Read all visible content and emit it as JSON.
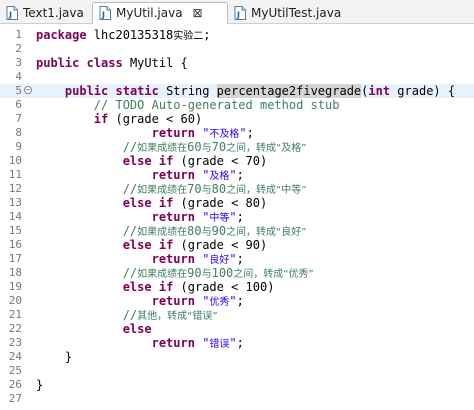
{
  "tabs": [
    {
      "label": "Text1.java",
      "active": false
    },
    {
      "label": "MyUtil.java",
      "active": true,
      "close": "⊠"
    },
    {
      "label": "MyUtilTest.java",
      "active": false
    }
  ],
  "editor": {
    "lines": [
      {
        "num": "1",
        "text": "package lhc20135318实验二;"
      },
      {
        "num": "2",
        "text": ""
      },
      {
        "num": "3",
        "text": "public class MyUtil {"
      },
      {
        "num": "4",
        "text": ""
      },
      {
        "num": "5",
        "text": "    public static String percentage2fivegrade(int grade) {"
      },
      {
        "num": "6",
        "text": "        // TODO Auto-generated method stub"
      },
      {
        "num": "7",
        "text": "        if (grade < 60)"
      },
      {
        "num": "8",
        "text": "                return \"不及格\";"
      },
      {
        "num": "9",
        "text": "            //如果成绩在60与70之间，转成“及格”"
      },
      {
        "num": "10",
        "text": "            else if (grade < 70)"
      },
      {
        "num": "11",
        "text": "                return \"及格\";"
      },
      {
        "num": "12",
        "text": "            //如果成绩在70与80之间，转成“中等”"
      },
      {
        "num": "13",
        "text": "            else if (grade < 80)"
      },
      {
        "num": "14",
        "text": "                return \"中等\";"
      },
      {
        "num": "15",
        "text": "            //如果成绩在80与90之间，转成“良好”"
      },
      {
        "num": "16",
        "text": "            else if (grade < 90)"
      },
      {
        "num": "17",
        "text": "                return \"良好\";"
      },
      {
        "num": "18",
        "text": "            //如果成绩在90与100之间，转成“优秀”"
      },
      {
        "num": "19",
        "text": "            else if (grade < 100)"
      },
      {
        "num": "20",
        "text": "                return \"优秀\";"
      },
      {
        "num": "21",
        "text": "            //其他，转成“错误”"
      },
      {
        "num": "22",
        "text": "            else"
      },
      {
        "num": "23",
        "text": "                return \"错误\";"
      },
      {
        "num": "24",
        "text": "    }"
      },
      {
        "num": "25",
        "text": ""
      },
      {
        "num": "26",
        "text": "}"
      },
      {
        "num": "27",
        "text": ""
      }
    ],
    "fold_marker": "−",
    "current_line": "5"
  },
  "colors": {
    "keyword": "#7f0055",
    "comment": "#3f7f5f",
    "string": "#2a00ff",
    "current_line_bg": "#e8f2fe"
  }
}
